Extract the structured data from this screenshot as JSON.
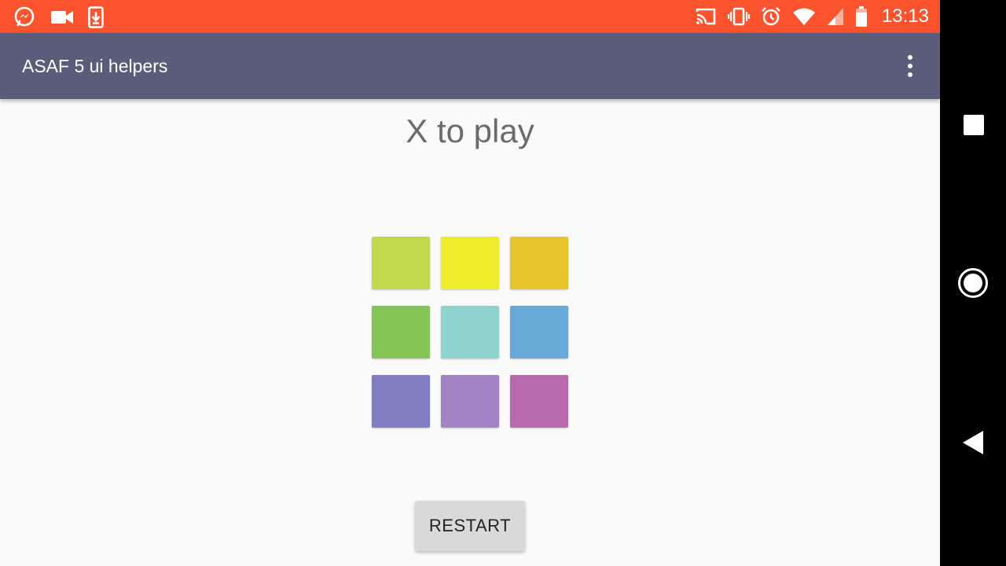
{
  "status_bar": {
    "time": "13:13",
    "left_icons": [
      "messenger-icon",
      "video-camera-icon",
      "download-icon"
    ],
    "right_icons": [
      "cast-icon",
      "vibrate-icon",
      "alarm-icon",
      "wifi-icon",
      "signal-icon",
      "battery-icon"
    ],
    "color": "#fa532e"
  },
  "app_bar": {
    "title": "ASAF 5 ui helpers",
    "overflow_icon": "more-vert-icon",
    "color": "#5a5d7a"
  },
  "game": {
    "status_text": "X to play",
    "board": [
      {
        "color": "#c1d94f"
      },
      {
        "color": "#f0ed2c"
      },
      {
        "color": "#e6c42c"
      },
      {
        "color": "#84c555"
      },
      {
        "color": "#8fd3cf"
      },
      {
        "color": "#68a9d9"
      },
      {
        "color": "#7f7ec3"
      },
      {
        "color": "#a283c3"
      },
      {
        "color": "#b86aae"
      }
    ],
    "restart_label": "RESTART"
  },
  "nav_bar": {
    "buttons": [
      "recents-square-icon",
      "home-circle-icon",
      "back-triangle-icon"
    ]
  }
}
